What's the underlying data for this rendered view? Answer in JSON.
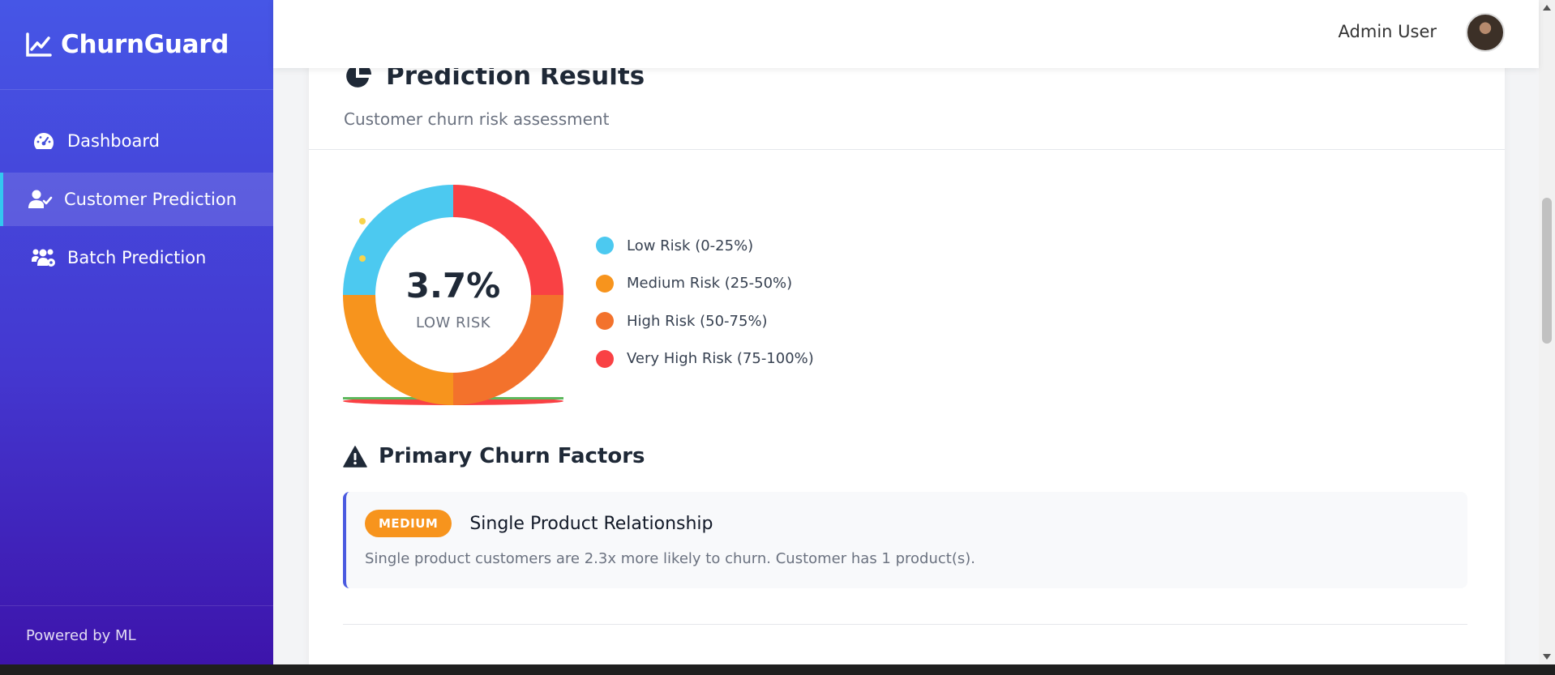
{
  "app": {
    "brand": "ChurnGuard",
    "footer": "Powered by ML"
  },
  "sidebar": {
    "items": [
      {
        "label": "Dashboard",
        "icon": "dashboard-gauge-icon",
        "active": false
      },
      {
        "label": "Customer Prediction",
        "icon": "user-check-icon",
        "active": true
      },
      {
        "label": "Batch Prediction",
        "icon": "users-gear-icon",
        "active": false
      }
    ]
  },
  "header": {
    "user_name": "Admin User"
  },
  "results": {
    "title": "Prediction Results",
    "subtitle": "Customer churn risk assessment",
    "gauge": {
      "value": "3.7%",
      "label": "LOW RISK",
      "probability": 0.037
    },
    "legend": [
      {
        "label": "Low Risk (0-25%)",
        "color": "#4cc9f0"
      },
      {
        "label": "Medium Risk (25-50%)",
        "color": "#f7941d"
      },
      {
        "label": "High Risk (50-75%)",
        "color": "#f3722c"
      },
      {
        "label": "Very High Risk (75-100%)",
        "color": "#f94144"
      }
    ]
  },
  "factors": {
    "title": "Primary Churn Factors",
    "items": [
      {
        "severity": "MEDIUM",
        "name": "Single Product Relationship",
        "description": "Single product customers are 2.3x more likely to churn. Customer has 1 product(s).",
        "severity_color": "#f7941d"
      }
    ]
  },
  "colors": {
    "accent": "#4a5ae0",
    "active_border": "#33c7f0"
  }
}
